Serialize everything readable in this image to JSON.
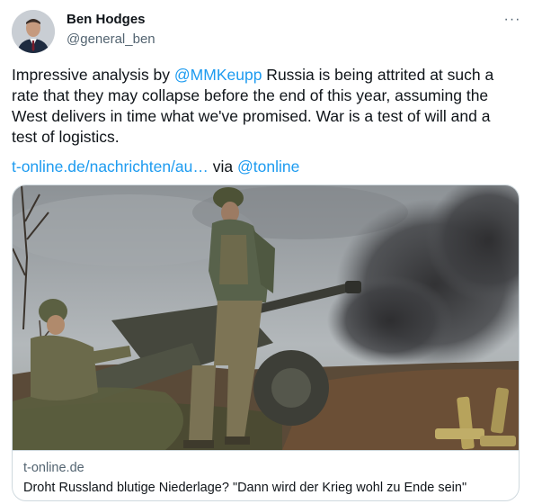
{
  "author": {
    "display_name": "Ben Hodges",
    "handle": "@general_ben"
  },
  "menu": {
    "more_icon": "more-horizontal-icon",
    "more_glyph": "···"
  },
  "tweet": {
    "text_prefix": "Impressive analysis by ",
    "mention": "@MMKeupp",
    "text_suffix": "   Russia is being attrited at such a rate that they may collapse before the end of this year, assuming the West delivers in time what we've promised. War is a test of will and a test of logistics.",
    "link_text": "t-online.de/nachrichten/au…",
    "via_text": " via ",
    "via_mention": "@tonline"
  },
  "card": {
    "domain": "t-online.de",
    "title": "Droht Russland blutige Niederlage? \"Dann wird der Krieg wohl zu Ende sein\""
  },
  "colors": {
    "link": "#1d9bf0",
    "text": "#0f1419",
    "secondary": "#536471",
    "border": "#cfd9de"
  }
}
